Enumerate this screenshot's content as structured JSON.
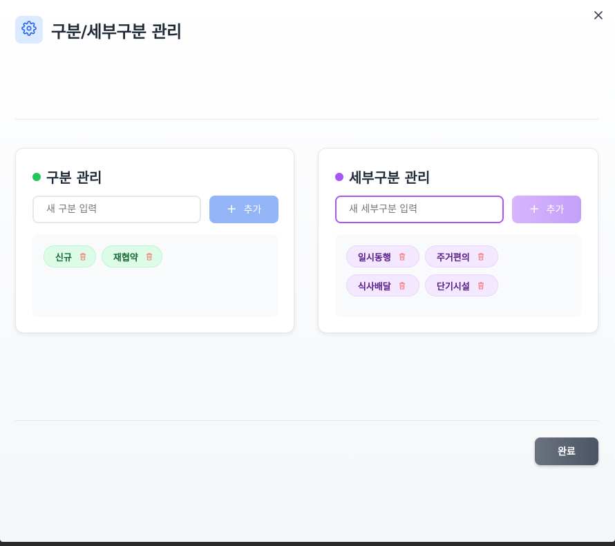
{
  "dialog": {
    "title": "구분/세부구분 관리",
    "icon": "gear-icon",
    "close_icon": "close-icon"
  },
  "category_panel": {
    "title": "구분 관리",
    "dot_color": "#22c55e",
    "input_placeholder": "새 구분 입력",
    "add_label": "추가",
    "tags": [
      {
        "label": "신규"
      },
      {
        "label": "재협약"
      }
    ]
  },
  "subcategory_panel": {
    "title": "세부구분 관리",
    "dot_color": "#a855f7",
    "input_placeholder": "새 세부구분 입력",
    "add_label": "추가",
    "tags": [
      {
        "label": "일시동행"
      },
      {
        "label": "주거편의"
      },
      {
        "label": "식사배달"
      },
      {
        "label": "단기시설"
      }
    ]
  },
  "footer": {
    "done_label": "완료"
  }
}
